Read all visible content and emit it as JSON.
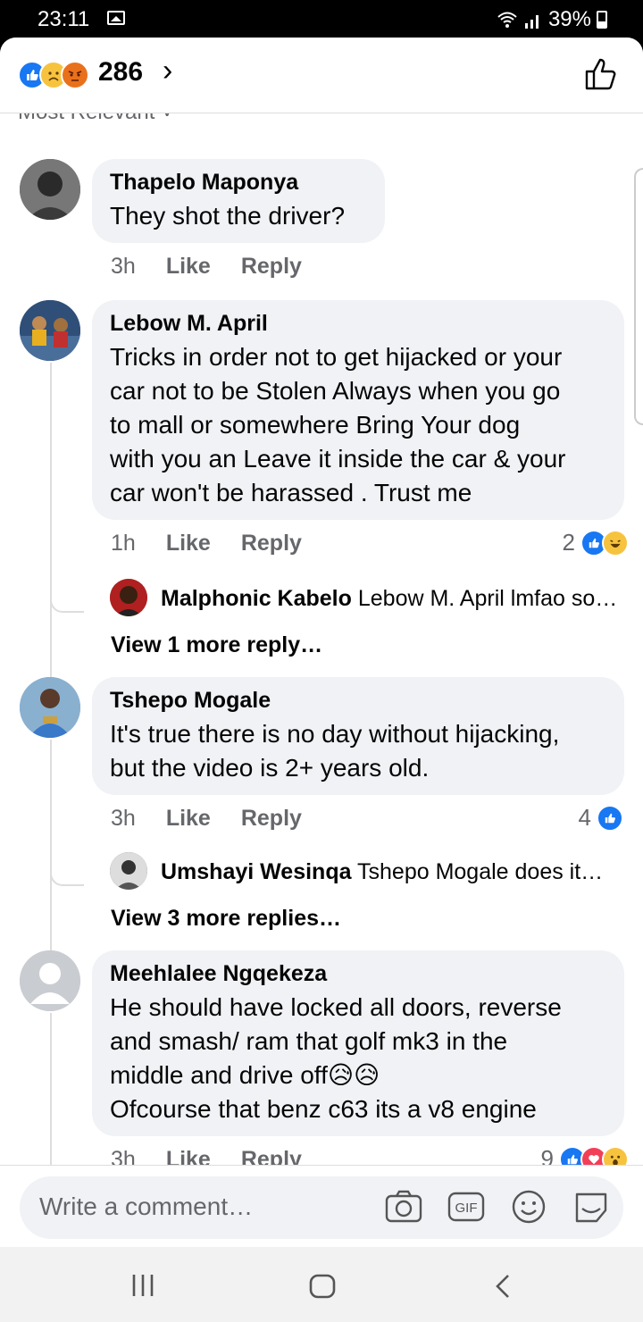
{
  "status": {
    "time": "23:11",
    "battery": "39%"
  },
  "header": {
    "reaction_count": "286",
    "sort_label": "Most Relevant"
  },
  "comments": [
    {
      "name": "Thapelo Maponya",
      "text": [
        "They shot the driver?"
      ],
      "time": "3h",
      "like": "Like",
      "reply": "Reply"
    },
    {
      "name": "Lebow M. April",
      "text": [
        "Tricks in order not to get hijacked or your",
        "car not to be Stolen Always when you go",
        "to mall or somewhere Bring Your dog",
        "with you an Leave it inside the car & your",
        "car won't be harassed . Trust me"
      ],
      "time": "1h",
      "like": "Like",
      "reply": "Reply",
      "reaction_count": "2",
      "reply_preview": {
        "name": "Malphonic Kabelo",
        "text": "Lebow M. April lmfao so…"
      },
      "more": "View 1 more reply…"
    },
    {
      "name": "Tshepo Mogale",
      "text": [
        "It's true there is no day without hijacking,",
        "but the video is 2+ years old."
      ],
      "time": "3h",
      "like": "Like",
      "reply": "Reply",
      "reaction_count": "4",
      "reply_preview": {
        "name": "Umshayi Wesinqa",
        "text": "Tshepo Mogale does it…"
      },
      "more": "View 3 more replies…"
    },
    {
      "name": "Meehlalee Ngqekeza",
      "text": [
        "He should have  locked all doors, reverse",
        "and smash/ ram that golf mk3 in the",
        "middle and drive off😥😥",
        "Ofcourse  that  benz c63 its a v8 engine"
      ],
      "time": "3h",
      "like": "Like",
      "reply": "Reply",
      "reaction_count": "9"
    }
  ],
  "composer": {
    "placeholder": "Write a comment…"
  },
  "icons": {
    "like": "like-icon",
    "sad": "sad-icon",
    "angry": "angry-icon",
    "haha": "haha-icon",
    "love": "love-icon",
    "wow": "wow-icon"
  },
  "colors": {
    "like_blue": "#1877f2",
    "bubble": "#f0f2f5",
    "meta_gray": "#65676b"
  }
}
